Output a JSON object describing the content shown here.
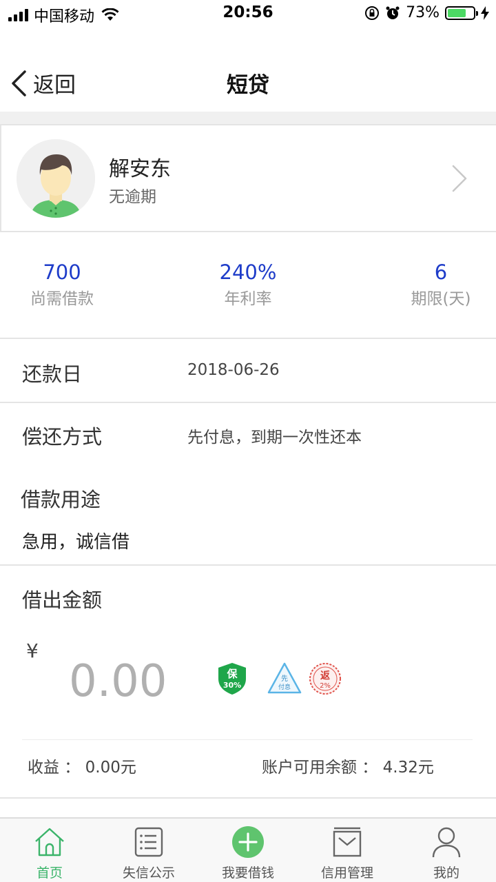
{
  "status_bar": {
    "carrier": "中国移动",
    "time": "20:56",
    "battery": "73%",
    "battery_level": 0.73
  },
  "nav": {
    "back_label": "返回",
    "title": "短贷"
  },
  "profile": {
    "name": "解安东",
    "status": "无逾期"
  },
  "stats": [
    {
      "value": "700",
      "label": "尚需借款"
    },
    {
      "value": "240%",
      "label": "年利率"
    },
    {
      "value": "6",
      "label": "期限(天)"
    }
  ],
  "details": {
    "repay_date_label": "还款日",
    "repay_date_value": "2018-06-26",
    "repay_method_label": "偿还方式",
    "repay_method_value": "先付息，到期一次性还本",
    "purpose_label": "借款用途",
    "purpose_value": "急用，诚信借"
  },
  "lend": {
    "label": "借出金额",
    "currency": "¥",
    "placeholder": "0.00",
    "badges": [
      {
        "text": "保",
        "sub": "30%",
        "color": "#1fa64a",
        "icon": "shield-badge"
      },
      {
        "text": "先",
        "sub": "付息",
        "color": "#5ab4e6",
        "icon": "triangle-badge"
      },
      {
        "text": "返",
        "sub": "2%",
        "color": "#e0524a",
        "icon": "circle-stamp-badge"
      }
    ],
    "earnings": "收益 ： 0.00元",
    "balance": "账户可用余额 ： 4.32元"
  },
  "tabs": [
    {
      "label": "首页",
      "icon": "home-icon",
      "active": true
    },
    {
      "label": "失信公示",
      "icon": "list-icon",
      "active": false
    },
    {
      "label": "我要借钱",
      "icon": "plus-circle-icon",
      "active": false
    },
    {
      "label": "信用管理",
      "icon": "inbox-icon",
      "active": false
    },
    {
      "label": "我的",
      "icon": "user-icon",
      "active": false
    }
  ],
  "colors": {
    "accent_green": "#3bb46a",
    "stat_blue": "#1e3cc9",
    "divider": "#e4e4e4"
  }
}
